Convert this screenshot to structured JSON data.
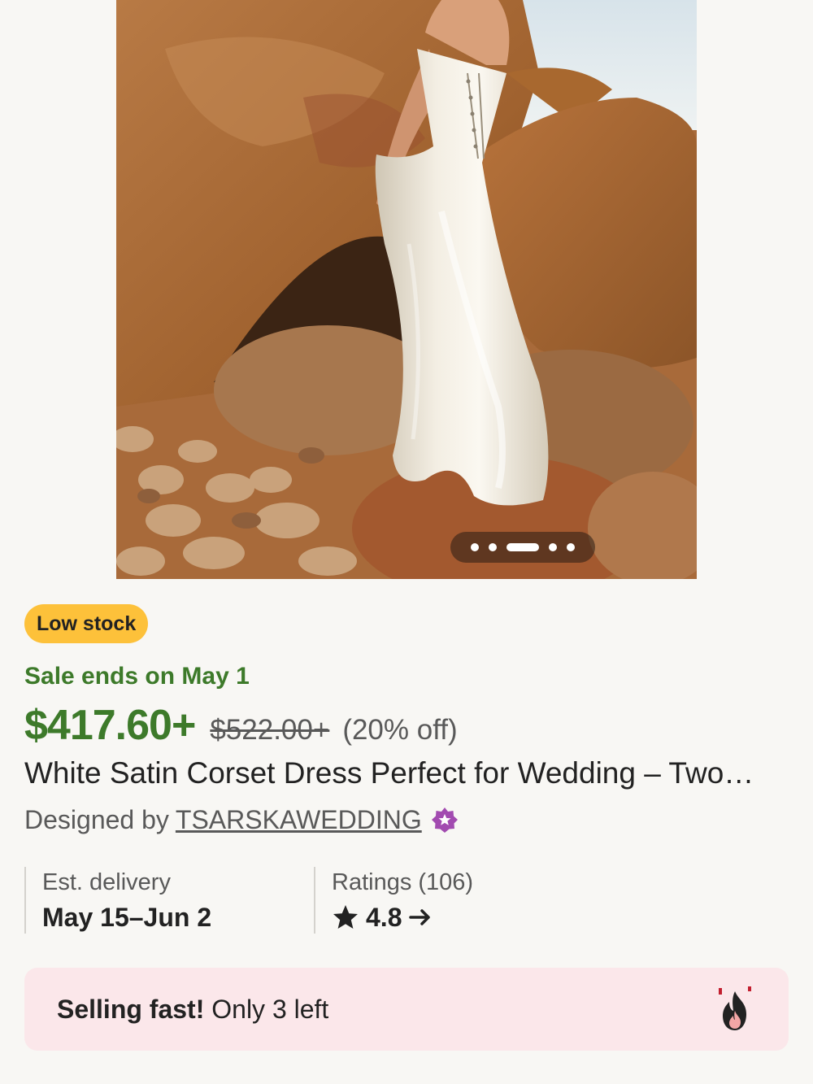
{
  "product": {
    "photo_alt": "White satin corset dress on rocks",
    "carousel": {
      "count": 5,
      "active_index": 2
    },
    "badge": "Low stock",
    "sale_ends": "Sale ends on May 1",
    "price_now": "$417.60+",
    "price_was": "$522.00+",
    "discount": "(20% off)",
    "title": "White Satin Corset Dress Perfect for Wedding – Two…",
    "designer_prefix": "Designed by",
    "shop_name": "TSARSKAWEDDING"
  },
  "delivery": {
    "label": "Est. delivery",
    "value": "May 15–Jun 2"
  },
  "ratings": {
    "label": "Ratings (106)",
    "value": "4.8"
  },
  "banner": {
    "strong": "Selling fast!",
    "rest": " Only 3 left",
    "icon": "fire-icon"
  },
  "colors": {
    "sale_green": "#3d7a2a",
    "badge_yellow": "#fdc13a",
    "star_seller_purple": "#a24bb0",
    "banner_pink": "#fbe7ea",
    "background": "#f8f7f4"
  }
}
